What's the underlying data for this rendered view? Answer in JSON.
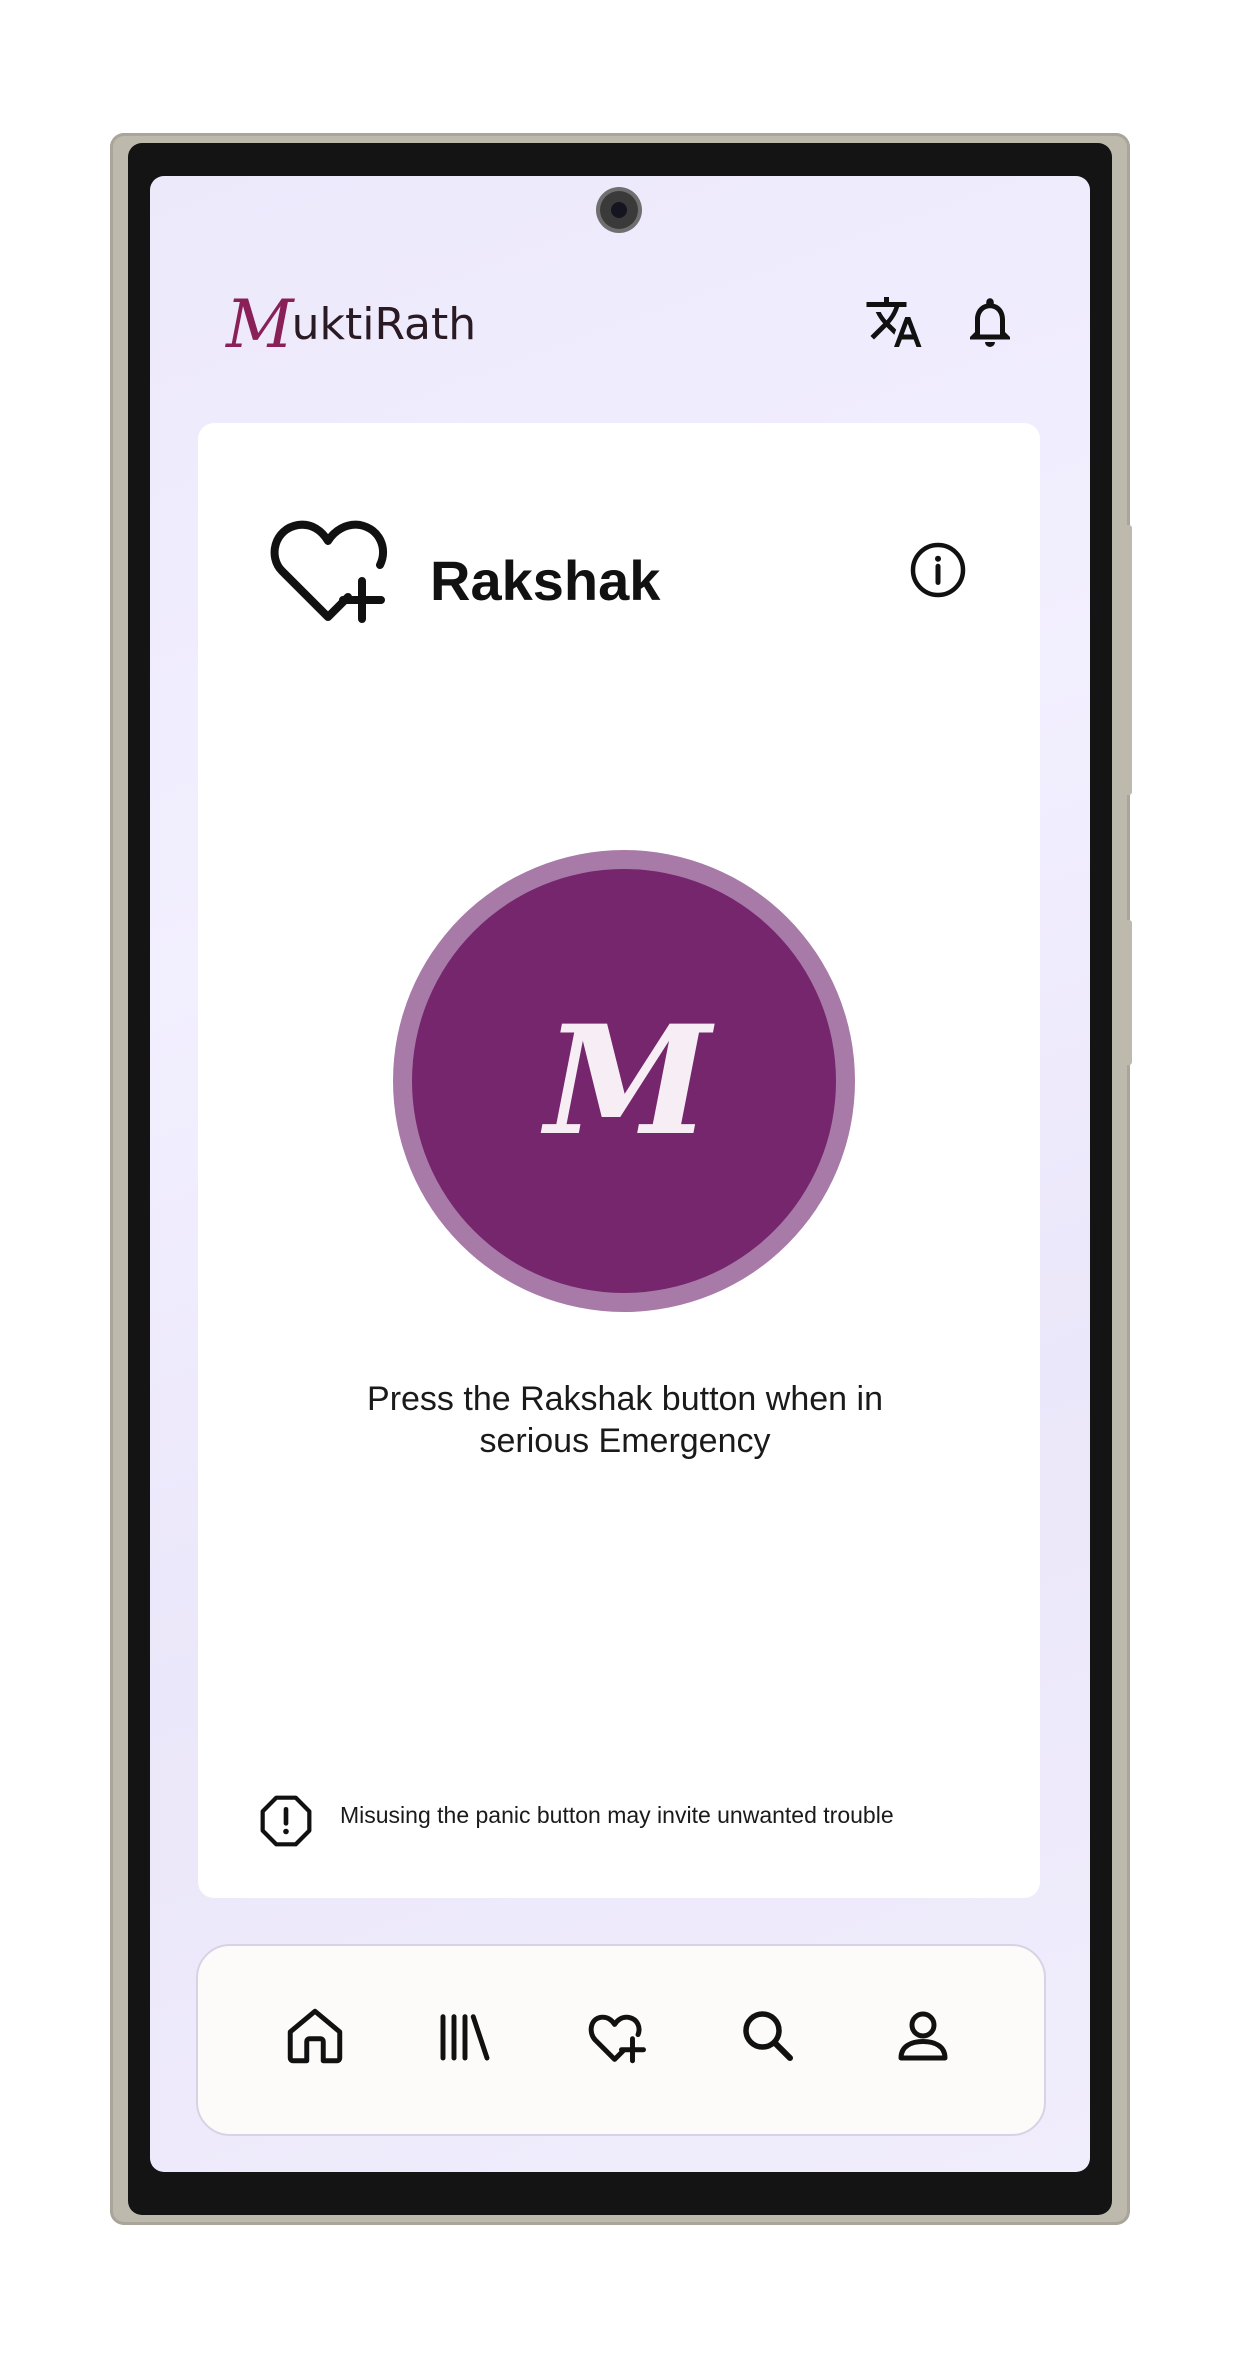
{
  "app": {
    "logo_mark": "M",
    "logo_text": "uktiRath"
  },
  "header": {
    "icons": [
      "translate-icon",
      "bell-icon"
    ]
  },
  "card": {
    "title": "Rakshak",
    "title_icon": "heart-plus-icon",
    "info_icon": "info-icon",
    "panic_glyph": "M",
    "instruction": "Press the Rakshak button when in serious Emergency",
    "warning": "Misusing the panic button may invite unwanted trouble",
    "warning_icon": "octagon-alert-icon"
  },
  "nav": {
    "items": [
      "home-icon",
      "library-icon",
      "heart-plus-icon",
      "search-icon",
      "person-icon"
    ]
  },
  "colors": {
    "brand": "#75266c",
    "brand_ring": "#a87aa8",
    "logo": "#8a2058",
    "screen_bg": "#efecfc"
  }
}
